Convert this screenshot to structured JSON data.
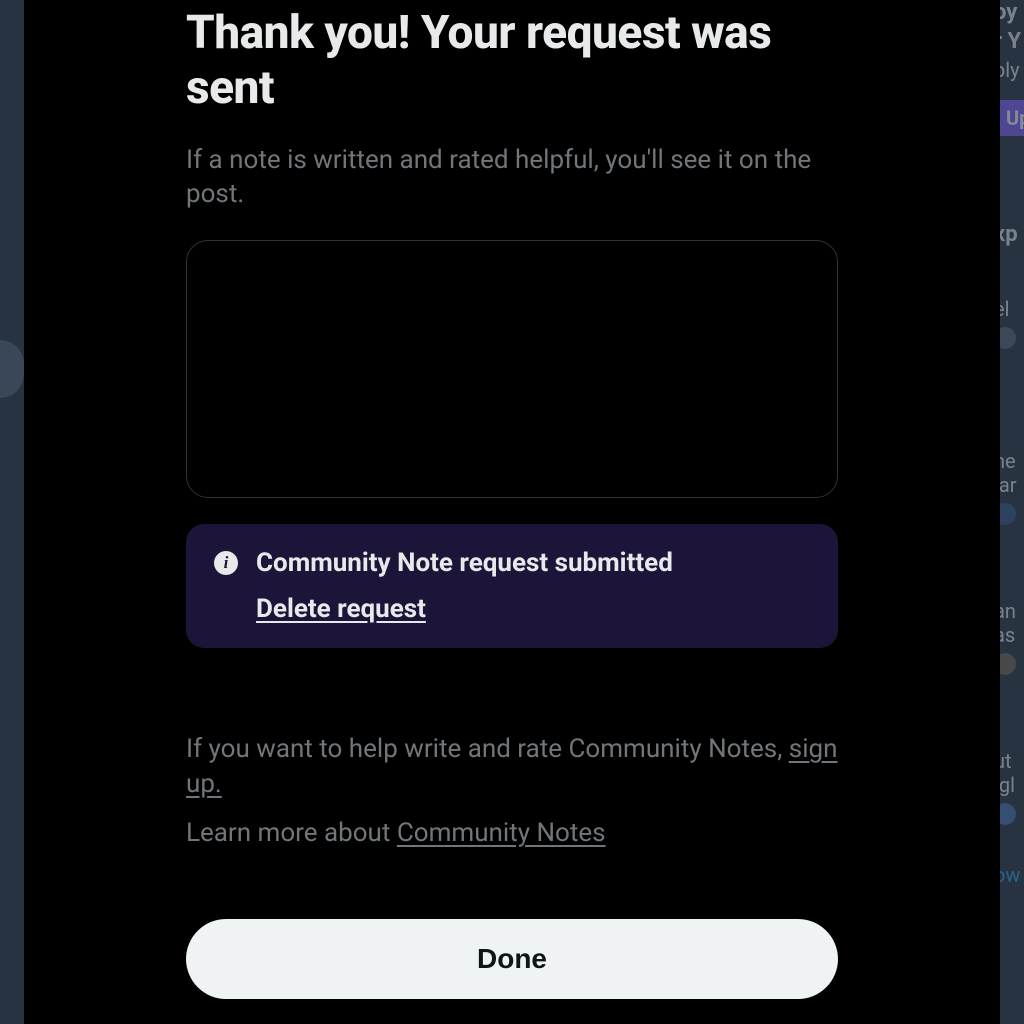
{
  "modal": {
    "title": "Thank you! Your request was sent",
    "subtitle": "If a note is written and rated helpful, you'll see it on the post.",
    "notification": {
      "title": "Community Note request submitted",
      "delete_label": "Delete request"
    },
    "help_text_prefix": "If you want to help write and rate Community Notes, ",
    "signup_link": "sign up.",
    "learn_more_prefix": "Learn more about ",
    "learn_more_link": "Community Notes",
    "done_button": "Done"
  },
  "background": {
    "items": [
      "oy",
      "r Y",
      "ply",
      "Up",
      "xp",
      "el",
      "ne",
      "lar",
      "an",
      "as",
      "ut",
      "igl",
      "ow"
    ]
  }
}
